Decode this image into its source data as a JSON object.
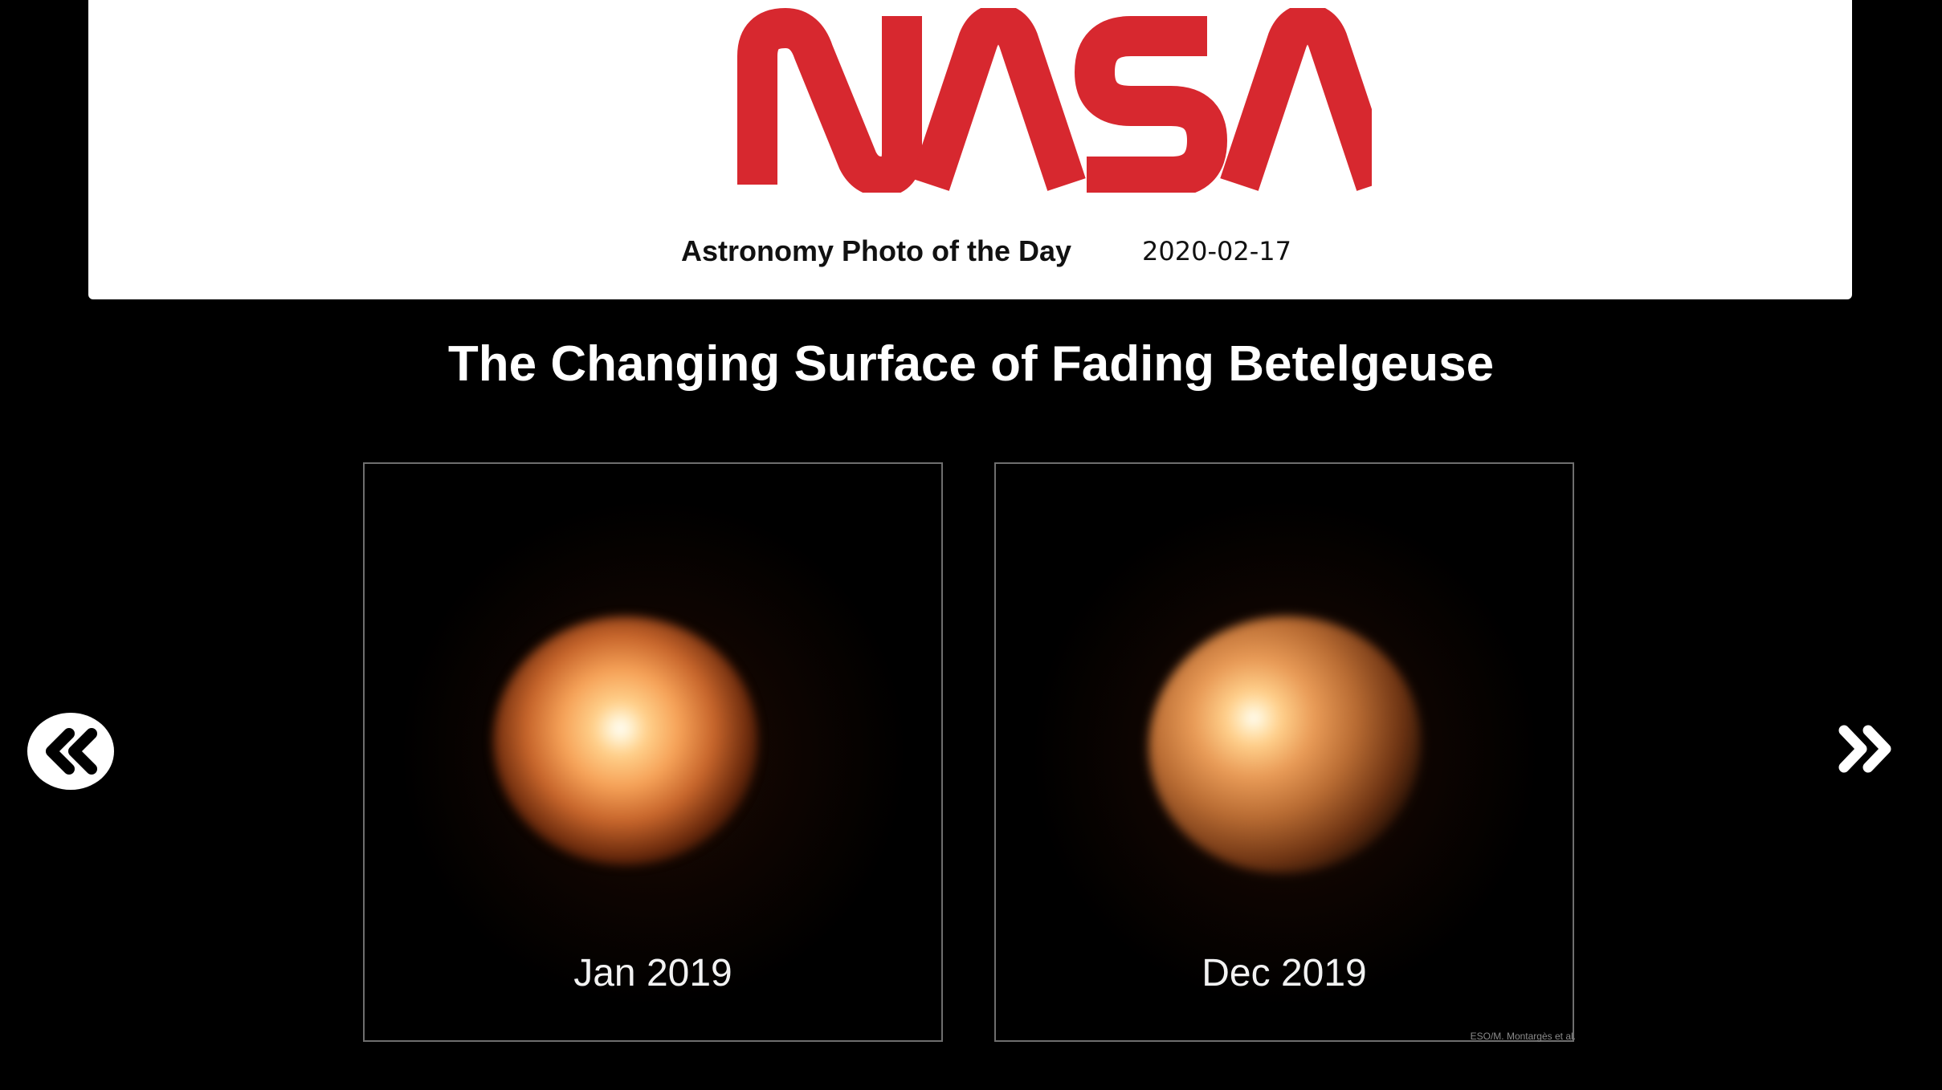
{
  "header": {
    "logo_text": "NASA",
    "brand_color": "#d7282f",
    "section_label": "Astronomy Photo of the Day",
    "date": "2020-02-17"
  },
  "photo": {
    "title": "The Changing Surface of Fading Betelgeuse",
    "panels": [
      {
        "caption": "Jan 2019"
      },
      {
        "caption": "Dec 2019"
      }
    ],
    "credit": "ESO/M. Montargès et al."
  },
  "navigation": {
    "prev_icon": "double-chevron-left-icon",
    "next_icon": "double-chevron-right-icon"
  }
}
